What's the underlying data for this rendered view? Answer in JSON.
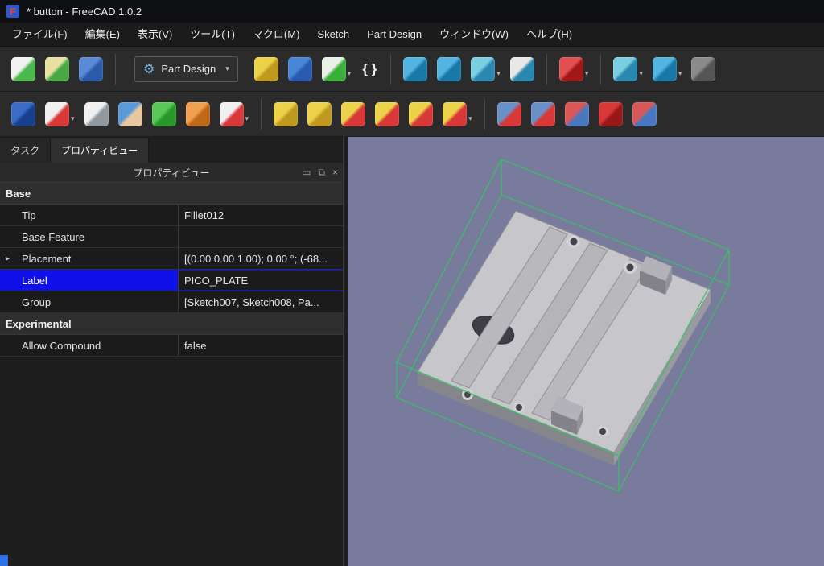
{
  "window": {
    "title": "* button - FreeCAD 1.0.2"
  },
  "menubar": [
    {
      "id": "file",
      "label": "ファイル(F)"
    },
    {
      "id": "edit",
      "label": "編集(E)"
    },
    {
      "id": "view",
      "label": "表示(V)"
    },
    {
      "id": "tools",
      "label": "ツール(T)"
    },
    {
      "id": "macro",
      "label": "マクロ(M)"
    },
    {
      "id": "sketch",
      "label": "Sketch"
    },
    {
      "id": "part-design",
      "label": "Part Design"
    },
    {
      "id": "window",
      "label": "ウィンドウ(W)"
    },
    {
      "id": "help",
      "label": "ヘルプ(H)"
    }
  ],
  "workbench": {
    "label": "Part Design",
    "arrow": "▾",
    "gear": "⚙"
  },
  "toolbars": {
    "file": [
      {
        "name": "new-document-icon",
        "c1": "#f2f2f2",
        "c2": "#4db84d"
      },
      {
        "name": "open-document-icon",
        "c1": "#e8e0a0",
        "c2": "#48a848"
      },
      {
        "name": "save-document-icon",
        "c1": "#5a8ad8",
        "c2": "#2a5aa8"
      }
    ],
    "standard": [
      {
        "name": "create-part-icon",
        "c1": "#ecd24a",
        "c2": "#c09a20"
      },
      {
        "name": "create-group-icon",
        "c1": "#4a86d8",
        "c2": "#2a5ab0"
      },
      {
        "name": "make-link-icon",
        "c1": "#e8f0e8",
        "c2": "#3ab03a",
        "menu": true
      },
      {
        "name": "macro-braces-icon",
        "glyph": "{ }",
        "color": "#f0f0f0"
      },
      {
        "sep": true
      },
      {
        "name": "fit-all-icon",
        "c1": "#52b4e0",
        "c2": "#1a78a8"
      },
      {
        "name": "fit-selection-icon",
        "c1": "#52b4e0",
        "c2": "#1a78a8"
      },
      {
        "name": "axonometric-view-icon",
        "c1": "#7ad0e0",
        "c2": "#2a88b0",
        "menu": true
      },
      {
        "name": "measure-icon",
        "c1": "#e8e8e8",
        "c2": "#2a88b0"
      },
      {
        "sep": true
      },
      {
        "name": "selection-filter-icon",
        "c1": "#e05050",
        "c2": "#a01818",
        "menu": true
      },
      {
        "sep": true
      },
      {
        "name": "draw-style-icon",
        "c1": "#7ad0e0",
        "c2": "#2a88b0",
        "menu": true
      },
      {
        "name": "refresh-view-icon",
        "c1": "#52b4e0",
        "c2": "#1a78a8",
        "menu": true
      },
      {
        "name": "more-tools-icon",
        "c1": "#8a8a8a",
        "c2": "#555555"
      }
    ],
    "part_design": [
      {
        "name": "create-body-icon",
        "c1": "#3a6cc8",
        "c2": "#18408e"
      },
      {
        "name": "create-sketch-icon",
        "c1": "#f0f0f0",
        "c2": "#d83838",
        "menu": true
      },
      {
        "name": "edit-sketch-icon",
        "c1": "#f0f0f0",
        "c2": "#9098a0"
      },
      {
        "name": "validate-sketch-icon",
        "c1": "#5a9ad8",
        "c2": "#e8c8a0"
      },
      {
        "name": "create-shapebinder-icon",
        "c1": "#58c858",
        "c2": "#28982a"
      },
      {
        "name": "create-clone-icon",
        "c1": "#f0a050",
        "c2": "#c06818"
      },
      {
        "name": "create-datum-icon",
        "c1": "#f0f0f0",
        "c2": "#d83838",
        "menu": true
      },
      {
        "sep": true
      },
      {
        "name": "pad-icon",
        "c1": "#ecd24a",
        "c2": "#c09a20"
      },
      {
        "name": "revolution-icon",
        "c1": "#ecd24a",
        "c2": "#c09a20"
      },
      {
        "name": "pocket-icon",
        "c1": "#ecd24a",
        "c2": "#d83838"
      },
      {
        "name": "groove-icon",
        "c1": "#ecd24a",
        "c2": "#d83838"
      },
      {
        "name": "additive-helix-icon",
        "c1": "#ecd24a",
        "c2": "#d83838"
      },
      {
        "name": "hole-icon",
        "c1": "#ecd24a",
        "c2": "#d83838",
        "menu": true
      },
      {
        "sep": true
      },
      {
        "name": "mirrored-icon",
        "c1": "#6a90c8",
        "c2": "#d83838"
      },
      {
        "name": "polar-pattern-icon",
        "c1": "#6a90c8",
        "c2": "#d83838"
      },
      {
        "name": "multitransform-icon",
        "c1": "#d85858",
        "c2": "#4a78c0"
      },
      {
        "name": "subtractive-primitive-icon",
        "c1": "#d83838",
        "c2": "#981818"
      },
      {
        "name": "boolean-operation-icon",
        "c1": "#d85858",
        "c2": "#4a78c0"
      }
    ]
  },
  "panel": {
    "tabs": [
      {
        "label": "タスク"
      },
      {
        "label": "プロパティビュー"
      }
    ],
    "title": "プロパティビュー",
    "window_controls": {
      "float": "▭",
      "undock": "⧉",
      "close": "×"
    },
    "sections": [
      {
        "title": "Base",
        "rows": [
          {
            "label": "Tip",
            "value": "Fillet012"
          },
          {
            "label": "Base Feature",
            "value": ""
          },
          {
            "label": "Placement",
            "value": "[(0.00 0.00 1.00); 0.00 °; (-68...",
            "expandable": true
          },
          {
            "label": "Label",
            "value": "PICO_PLATE",
            "selected": true
          },
          {
            "label": "Group",
            "value": "[Sketch007, Sketch008, Pa..."
          }
        ]
      },
      {
        "title": "Experimental",
        "rows": [
          {
            "label": "Allow Compound",
            "value": "false"
          }
        ]
      }
    ]
  },
  "colors": {
    "titlebar": "#0e1013",
    "selection": "#1010e8",
    "viewport_bg": "#797b9d",
    "highlight_green": "#36c463",
    "corner_accent": "#2f72e8",
    "model_gray": "#c7c7cb"
  }
}
